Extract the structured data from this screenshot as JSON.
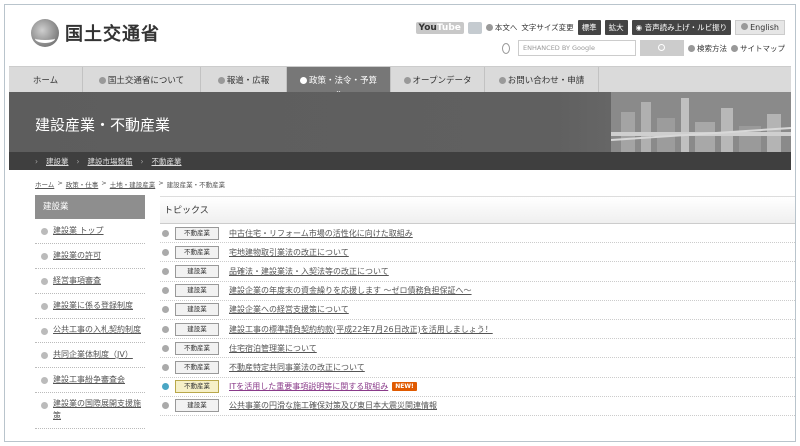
{
  "header": {
    "logo_text": "国土交通省",
    "youtube": "You",
    "youtube_b": "Tube",
    "util_links": [
      "本文へ"
    ],
    "font_size_label": "文字サイズ変更",
    "font_standard": "標準",
    "font_large": "拡大",
    "voice_label": "音声読み上げ・ルビ振り",
    "english": "English",
    "search_placeholder": "ENHANCED BY Google",
    "search_method": "検索方法",
    "sitemap": "サイトマップ"
  },
  "nav": {
    "items": [
      {
        "label": "ホーム"
      },
      {
        "label": "国土交通省について"
      },
      {
        "label": "報道・広報"
      },
      {
        "label": "政策・法令・予算"
      },
      {
        "label": "オープンデータ"
      },
      {
        "label": "お問い合わせ・申請"
      }
    ]
  },
  "banner": {
    "title": "建設産業・不動産業",
    "crumbs": [
      "建設業",
      "建設市場整備",
      "不動産業"
    ]
  },
  "breadcrumb": {
    "items": [
      "ホーム",
      "政策・仕事",
      "土地・建設産業",
      "建設産業・不動産業"
    ]
  },
  "sidebar": {
    "head": "建設業",
    "items": [
      "建設業 トップ",
      "建設業の許可",
      "経営事項審査",
      "建設業に係る登録制度",
      "公共工事の入札契約制度",
      "共同企業体制度（JV）",
      "建設工事紛争審査会",
      "建設業の国際展開支援施策"
    ]
  },
  "topics": {
    "head": "トピックス",
    "new_label": "NEW!",
    "rows": [
      {
        "tag": "不動産業",
        "text": "中古住宅・リフォーム市場の活性化に向けた取組み"
      },
      {
        "tag": "不動産業",
        "text": "宅地建物取引業法の改正について"
      },
      {
        "tag": "建設業",
        "text": "品確法・建設業法・入契法等の改正について"
      },
      {
        "tag": "建設業",
        "text": "建設企業の年度末の資金繰りを応援します 〜ゼロ債務負担保証へ〜"
      },
      {
        "tag": "建設業",
        "text": "建設企業への経営支援策について"
      },
      {
        "tag": "建設業",
        "text": "建設工事の標準請負契約約款(平成22年7月26日改正)を活用しましょう！"
      },
      {
        "tag": "不動産業",
        "text": "住宅宿泊管理業について"
      },
      {
        "tag": "不動産業",
        "text": "不動産特定共同事業法の改正について"
      },
      {
        "tag": "不動産業",
        "text": "ITを活用した重要事項説明等に関する取組み"
      },
      {
        "tag": "建設業",
        "text": "公共事業の円滑な施工確保対策及び東日本大震災関連情報"
      }
    ]
  }
}
